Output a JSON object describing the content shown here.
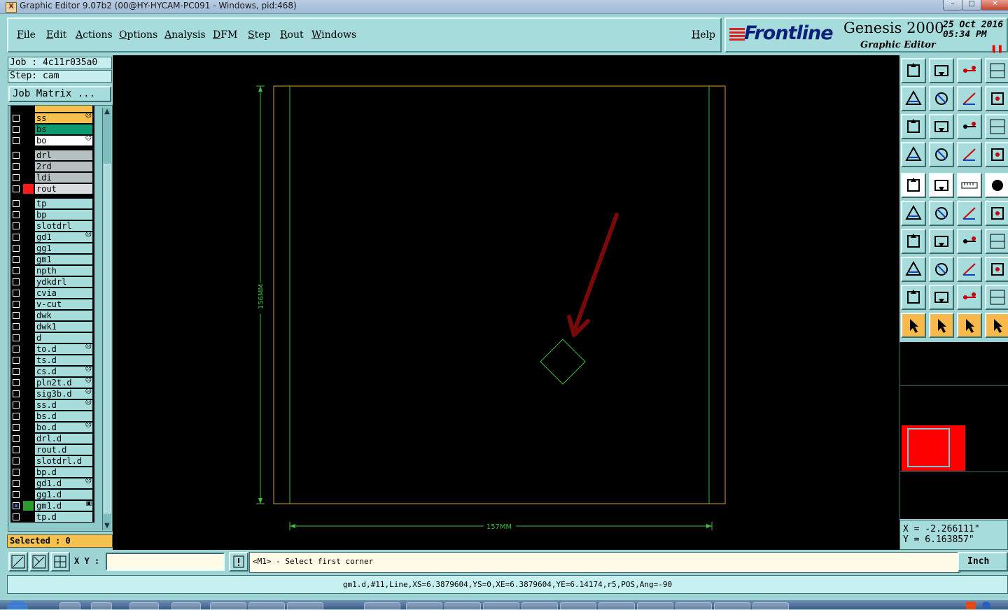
{
  "window": {
    "title": "Graphic Editor 9.07b2 (00@HY-HYCAM-PC091 - Windows, pid:468)"
  },
  "menu": {
    "file": "File",
    "edit": "Edit",
    "actions": "Actions",
    "options": "Options",
    "analysis": "Analysis",
    "dfm": "DFM",
    "step": "Step",
    "rout": "Rout",
    "windows": "Windows",
    "help": "Help"
  },
  "brand": {
    "logo": "Frontline",
    "product": "Genesis 2000",
    "subtitle": "Graphic Editor",
    "date": "25 Oct 2016",
    "time": "05:34 PM"
  },
  "job": {
    "job_line": "Job : 4c11r035a0",
    "step_line": "Step: cam",
    "matrix_button": "Job Matrix ..."
  },
  "layers": [
    {
      "name": "ss",
      "color": "#f6c14e",
      "marker": "☹"
    },
    {
      "name": "bs",
      "color": "#0e9a72",
      "marker": ""
    },
    {
      "name": "bo",
      "color": "#ffffff",
      "marker": "☹"
    },
    {
      "name": "drl",
      "color": "#b5c0c0",
      "marker": ""
    },
    {
      "name": "2rd",
      "color": "#b5c0c0",
      "marker": ""
    },
    {
      "name": "ldi",
      "color": "#b5c0c0",
      "marker": ""
    },
    {
      "name": "rout",
      "color": "#d8dcdc",
      "marker": "",
      "swatch": "#ff1a1a"
    },
    {
      "name": "tp",
      "color": "#a6dcdc",
      "marker": ""
    },
    {
      "name": "bp",
      "color": "#a6dcdc",
      "marker": ""
    },
    {
      "name": "slotdrl",
      "color": "#a6dcdc",
      "marker": ""
    },
    {
      "name": "gd1",
      "color": "#a6dcdc",
      "marker": "☹"
    },
    {
      "name": "gg1",
      "color": "#a6dcdc",
      "marker": ""
    },
    {
      "name": "gm1",
      "color": "#a6dcdc",
      "marker": ""
    },
    {
      "name": "npth",
      "color": "#a6dcdc",
      "marker": ""
    },
    {
      "name": "ydkdrl",
      "color": "#a6dcdc",
      "marker": ""
    },
    {
      "name": "cvia",
      "color": "#a6dcdc",
      "marker": ""
    },
    {
      "name": "v-cut",
      "color": "#a6dcdc",
      "marker": ""
    },
    {
      "name": "dwk",
      "color": "#a6dcdc",
      "marker": ""
    },
    {
      "name": "dwk1",
      "color": "#a6dcdc",
      "marker": ""
    },
    {
      "name": "d",
      "color": "#a6dcdc",
      "marker": ""
    },
    {
      "name": "to.d",
      "color": "#a6dcdc",
      "marker": "☹"
    },
    {
      "name": "ts.d",
      "color": "#a6dcdc",
      "marker": ""
    },
    {
      "name": "cs.d",
      "color": "#a6dcdc",
      "marker": "☹"
    },
    {
      "name": "pln2t.d",
      "color": "#a6dcdc",
      "marker": "☹"
    },
    {
      "name": "sig3b.d",
      "color": "#a6dcdc",
      "marker": "☹"
    },
    {
      "name": "ss.d",
      "color": "#a6dcdc",
      "marker": "☹"
    },
    {
      "name": "bs.d",
      "color": "#a6dcdc",
      "marker": ""
    },
    {
      "name": "bo.d",
      "color": "#a6dcdc",
      "marker": "☹"
    },
    {
      "name": "drl.d",
      "color": "#a6dcdc",
      "marker": ""
    },
    {
      "name": "rout.d",
      "color": "#a6dcdc",
      "marker": ""
    },
    {
      "name": "slotdrl.d",
      "color": "#a6dcdc",
      "marker": ""
    },
    {
      "name": "bp.d",
      "color": "#a6dcdc",
      "marker": ""
    },
    {
      "name": "gd1.d",
      "color": "#a6dcdc",
      "marker": "☹"
    },
    {
      "name": "gg1.d",
      "color": "#a6dcdc",
      "marker": ""
    },
    {
      "name": "gm1.d",
      "color": "#a6dcdc",
      "marker": "▣",
      "swatch": "#2e9a2e",
      "active": true
    },
    {
      "name": "tp.d",
      "color": "#a6dcdc",
      "marker": ""
    }
  ],
  "selected_text": "Selected : 0",
  "canvas": {
    "dim_vertical": "156MM",
    "dim_horizontal": "157MM"
  },
  "coords": {
    "x_line": "X = -2.266111\"",
    "y_line": "Y = 6.163857\""
  },
  "command": {
    "xy_label": "X Y :",
    "xy_value": "",
    "prompt": "<M1> - Select first corner",
    "unit": "Inch"
  },
  "status": "gm1.d,#11,Line,XS=6.3879604,YS=0,XE=6.3879604,YE=6.14174,r5,POS,Ang=-90"
}
